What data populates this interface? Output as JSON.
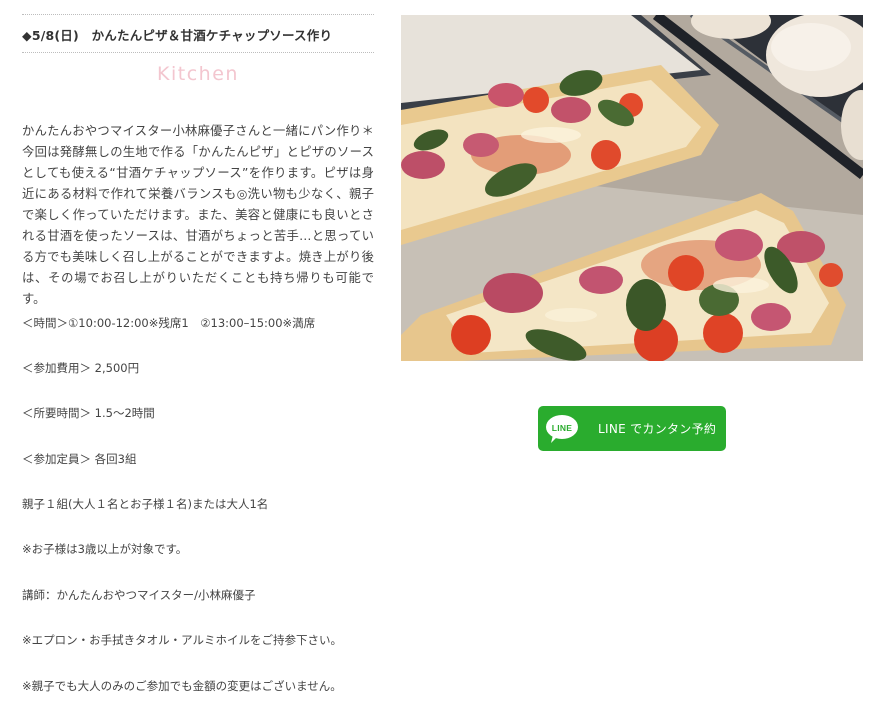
{
  "event": {
    "title": "◆5/8(日)　かんたんピザ＆甘酒ケチャップソース作り",
    "tag": "Kitchen",
    "description": "かんたんおやつマイスター小林麻優子さんと一緒にパン作り＊今回は発酵無しの生地で作る「かんたんピザ」とピザのソースとしても使える“甘酒ケチャップソース”を作ります。ピザは身近にある材料で作れて栄養バランスも◎洗い物も少なく、親子で楽しく作っていただけます。また、美容と健康にも良いとされる甘酒を使ったソースは、甘酒がちょっと苦手…と思っている方でも美味しく召し上がることができますよ。焼き上がり後は、その場でお召し上がりいただくことも持ち帰りも可能です。"
  },
  "details": [
    "＜時間＞①10:00-12:00※残席1　②13:00–15:00※満席",
    "＜参加費用＞ 2,500円",
    "＜所要時間＞ 1.5～2時間",
    "＜参加定員＞ 各回3組",
    "親子１組(大人１名とお子様１名)または大人1名",
    "※お子様は3歳以上が対象です。",
    "講師：かんたんおやつマイスター/小林麻優子",
    "※エプロン・お手拭きタオル・アルミホイルをご持参下さい。",
    "※親子でも大人のみのご参加でも金額の変更はございません。"
  ],
  "reserve_button": {
    "logo_text": "LINE",
    "label": "LINE でカンタン予約",
    "color": "#2aac2e"
  },
  "photo": {
    "icon": "pizza-photo"
  }
}
